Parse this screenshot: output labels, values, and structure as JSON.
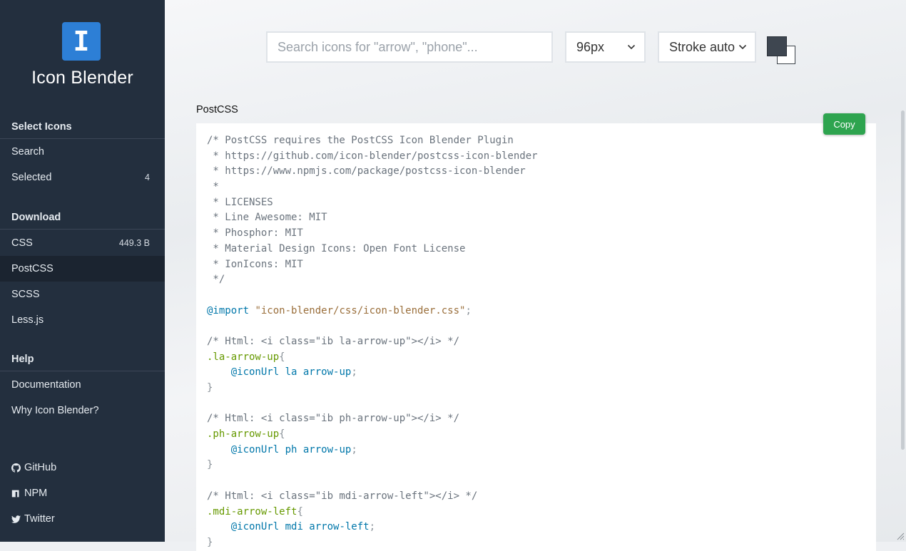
{
  "app": {
    "title": "Icon Blender",
    "logo_glyph": "I"
  },
  "sidebar": {
    "sections": [
      {
        "heading": "Select Icons",
        "items": [
          {
            "label": "Search",
            "badge": ""
          },
          {
            "label": "Selected",
            "badge": "4"
          }
        ]
      },
      {
        "heading": "Download",
        "items": [
          {
            "label": "CSS",
            "badge": "449.3 B"
          },
          {
            "label": "PostCSS",
            "badge": "",
            "active": true
          },
          {
            "label": "SCSS",
            "badge": ""
          },
          {
            "label": "Less.js",
            "badge": ""
          }
        ]
      },
      {
        "heading": "Help",
        "items": [
          {
            "label": "Documentation",
            "badge": ""
          },
          {
            "label": "Why Icon Blender?",
            "badge": ""
          }
        ]
      }
    ],
    "links": [
      {
        "label": "GitHub",
        "icon": "github-icon"
      },
      {
        "label": "NPM",
        "icon": "npm-icon"
      },
      {
        "label": "Twitter",
        "icon": "twitter-icon"
      }
    ]
  },
  "toolbar": {
    "search_placeholder": "Search icons for \"arrow\", \"phone\"...",
    "size_value": "96px",
    "stroke_value": "Stroke auto",
    "fg_color": "#3e4650",
    "bg_color": "#ffffff"
  },
  "panel": {
    "label": "PostCSS",
    "copy_label": "Copy",
    "code_lines": [
      [
        [
          "comment",
          "/* PostCSS requires the PostCSS Icon Blender Plugin"
        ]
      ],
      [
        [
          "comment",
          " * https://github.com/icon-blender/postcss-icon-blender"
        ]
      ],
      [
        [
          "comment",
          " * https://www.npmjs.com/package/postcss-icon-blender"
        ]
      ],
      [
        [
          "comment",
          " *"
        ]
      ],
      [
        [
          "comment",
          " * LICENSES"
        ]
      ],
      [
        [
          "comment",
          " * Line Awesome: MIT"
        ]
      ],
      [
        [
          "comment",
          " * Phosphor: MIT"
        ]
      ],
      [
        [
          "comment",
          " * Material Design Icons: Open Font License"
        ]
      ],
      [
        [
          "comment",
          " * IonIcons: MIT"
        ]
      ],
      [
        [
          "comment",
          " */"
        ]
      ],
      [],
      [
        [
          "at",
          "@import"
        ],
        [
          "plain",
          " "
        ],
        [
          "string",
          "\"icon-blender/css/icon-blender.css\""
        ],
        [
          "punc",
          ";"
        ]
      ],
      [],
      [
        [
          "comment",
          "/* Html: <i class=\"ib la-arrow-up\"></i> */"
        ]
      ],
      [
        [
          "sel",
          ".la-arrow-up"
        ],
        [
          "punc",
          "{"
        ]
      ],
      [
        [
          "plain",
          "    "
        ],
        [
          "at",
          "@iconUrl"
        ],
        [
          "plain",
          " la arrow-up"
        ],
        [
          "punc",
          ";"
        ]
      ],
      [
        [
          "punc",
          "}"
        ]
      ],
      [],
      [
        [
          "comment",
          "/* Html: <i class=\"ib ph-arrow-up\"></i> */"
        ]
      ],
      [
        [
          "sel",
          ".ph-arrow-up"
        ],
        [
          "punc",
          "{"
        ]
      ],
      [
        [
          "plain",
          "    "
        ],
        [
          "at",
          "@iconUrl"
        ],
        [
          "plain",
          " ph arrow-up"
        ],
        [
          "punc",
          ";"
        ]
      ],
      [
        [
          "punc",
          "}"
        ]
      ],
      [],
      [
        [
          "comment",
          "/* Html: <i class=\"ib mdi-arrow-left\"></i> */"
        ]
      ],
      [
        [
          "sel",
          ".mdi-arrow-left"
        ],
        [
          "punc",
          "{"
        ]
      ],
      [
        [
          "plain",
          "    "
        ],
        [
          "at",
          "@iconUrl"
        ],
        [
          "plain",
          " mdi arrow-left"
        ],
        [
          "punc",
          ";"
        ]
      ],
      [
        [
          "punc",
          "}"
        ]
      ]
    ]
  }
}
